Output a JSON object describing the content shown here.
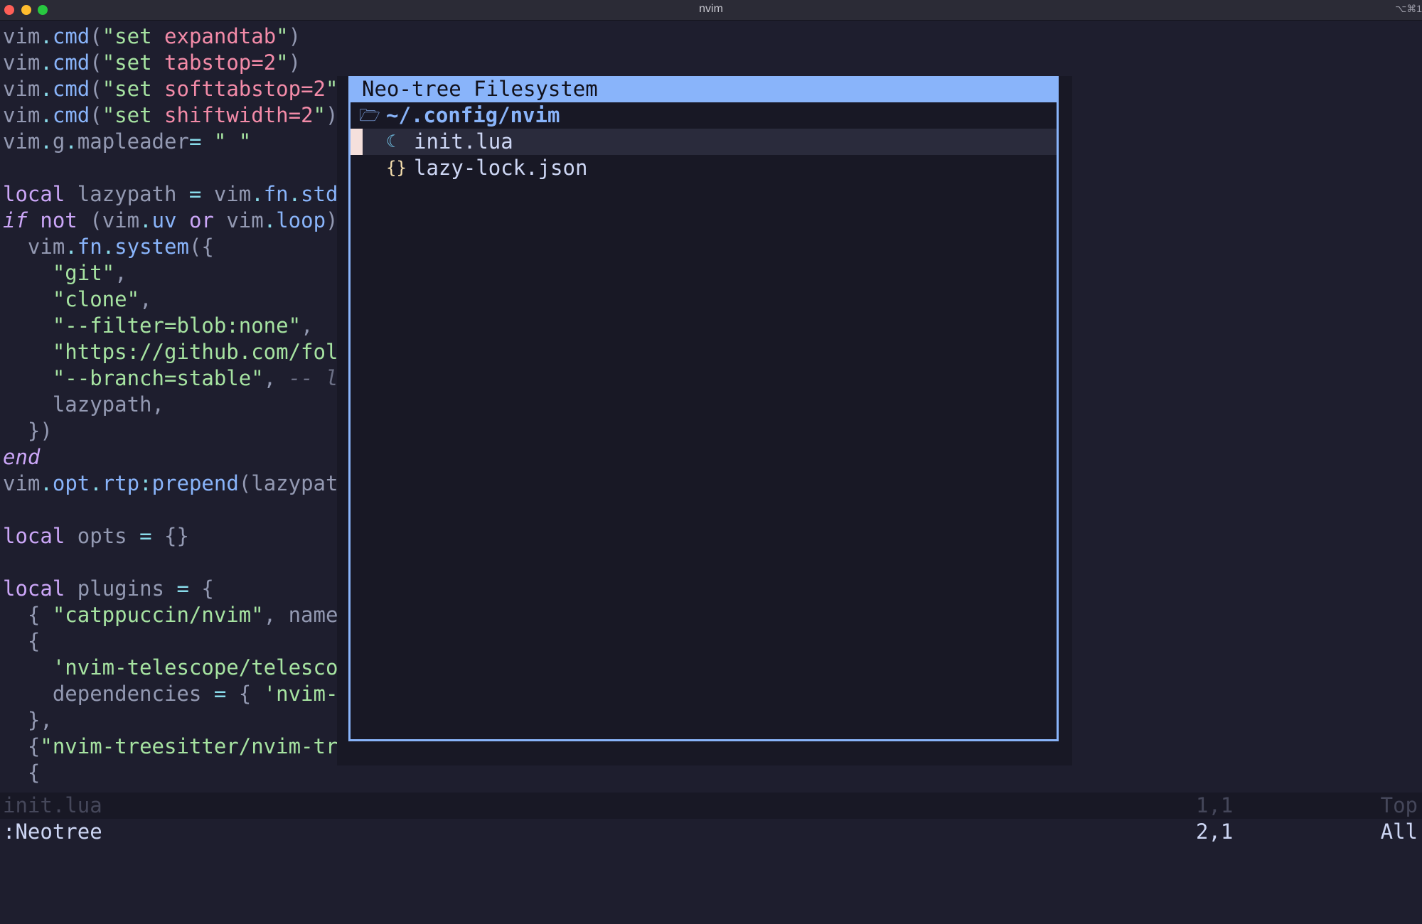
{
  "window": {
    "title": "nvim",
    "shortcut": "⌥⌘1"
  },
  "editor": {
    "lines": [
      [
        [
          "pc",
          "vim"
        ],
        [
          "op",
          "."
        ],
        [
          "fn",
          "cmd"
        ],
        [
          "pc",
          "("
        ],
        [
          "str",
          "\"set "
        ],
        [
          "tk",
          "expandtab"
        ],
        [
          "str",
          "\""
        ],
        [
          "pc",
          ")"
        ]
      ],
      [
        [
          "pc",
          "vim"
        ],
        [
          "op",
          "."
        ],
        [
          "fn",
          "cmd"
        ],
        [
          "pc",
          "("
        ],
        [
          "str",
          "\"set "
        ],
        [
          "tk",
          "tabstop=2"
        ],
        [
          "str",
          "\""
        ],
        [
          "pc",
          ")"
        ]
      ],
      [
        [
          "pc",
          "vim"
        ],
        [
          "op",
          "."
        ],
        [
          "fn",
          "cmd"
        ],
        [
          "pc",
          "("
        ],
        [
          "str",
          "\"set "
        ],
        [
          "tk",
          "softtabstop=2"
        ],
        [
          "str",
          "\""
        ]
      ],
      [
        [
          "pc",
          "vim"
        ],
        [
          "op",
          "."
        ],
        [
          "fn",
          "cmd"
        ],
        [
          "pc",
          "("
        ],
        [
          "str",
          "\"set "
        ],
        [
          "tk",
          "shiftwidth=2"
        ],
        [
          "str",
          "\""
        ],
        [
          "pc",
          ")"
        ]
      ],
      [
        [
          "pc",
          "vim"
        ],
        [
          "op",
          "."
        ],
        [
          "pc",
          "g"
        ],
        [
          "op",
          "."
        ],
        [
          "pc",
          "mapleader"
        ],
        [
          "op",
          "="
        ],
        [
          "pc",
          " "
        ],
        [
          "str",
          "\" \""
        ]
      ],
      [],
      [
        [
          "kw",
          "local"
        ],
        [
          "pc",
          " lazypath "
        ],
        [
          "op",
          "="
        ],
        [
          "pc",
          " vim"
        ],
        [
          "op",
          "."
        ],
        [
          "fn",
          "fn"
        ],
        [
          "op",
          "."
        ],
        [
          "fn",
          "std"
        ]
      ],
      [
        [
          "ikw",
          "if"
        ],
        [
          "pc",
          " "
        ],
        [
          "kw",
          "not"
        ],
        [
          "pc",
          " (vim"
        ],
        [
          "op",
          "."
        ],
        [
          "fn",
          "uv"
        ],
        [
          "pc",
          " "
        ],
        [
          "kw",
          "or"
        ],
        [
          "pc",
          " vim"
        ],
        [
          "op",
          "."
        ],
        [
          "fn",
          "loop"
        ],
        [
          "pc",
          ")"
        ]
      ],
      [
        [
          "pc",
          "  vim"
        ],
        [
          "op",
          "."
        ],
        [
          "fn",
          "fn"
        ],
        [
          "op",
          "."
        ],
        [
          "fn",
          "system"
        ],
        [
          "pc",
          "({"
        ]
      ],
      [
        [
          "pc",
          "    "
        ],
        [
          "str",
          "\"git\""
        ],
        [
          "pc",
          ","
        ]
      ],
      [
        [
          "pc",
          "    "
        ],
        [
          "str",
          "\"clone\""
        ],
        [
          "pc",
          ","
        ]
      ],
      [
        [
          "pc",
          "    "
        ],
        [
          "str",
          "\"--filter=blob:none\""
        ],
        [
          "pc",
          ","
        ]
      ],
      [
        [
          "pc",
          "    "
        ],
        [
          "str",
          "\"https://github.com/fol"
        ]
      ],
      [
        [
          "pc",
          "    "
        ],
        [
          "str",
          "\"--branch=stable\""
        ],
        [
          "pc",
          ", "
        ],
        [
          "cmt",
          "-- l"
        ]
      ],
      [
        [
          "pc",
          "    lazypath,"
        ]
      ],
      [
        [
          "pc",
          "  })"
        ]
      ],
      [
        [
          "ikw",
          "end"
        ]
      ],
      [
        [
          "pc",
          "vim"
        ],
        [
          "op",
          "."
        ],
        [
          "fn",
          "opt"
        ],
        [
          "op",
          "."
        ],
        [
          "fn",
          "rtp"
        ],
        [
          "op",
          ":"
        ],
        [
          "fn",
          "prepend"
        ],
        [
          "pc",
          "(lazypat"
        ]
      ],
      [],
      [
        [
          "kw",
          "local"
        ],
        [
          "pc",
          " opts "
        ],
        [
          "op",
          "="
        ],
        [
          "pc",
          " {}"
        ]
      ],
      [],
      [
        [
          "kw",
          "local"
        ],
        [
          "pc",
          " plugins "
        ],
        [
          "op",
          "="
        ],
        [
          "pc",
          " {"
        ]
      ],
      [
        [
          "pc",
          "  { "
        ],
        [
          "str",
          "\"catppuccin/nvim\""
        ],
        [
          "pc",
          ", name"
        ]
      ],
      [
        [
          "pc",
          "  {"
        ]
      ],
      [
        [
          "pc",
          "    "
        ],
        [
          "str",
          "'nvim-telescope/telesco"
        ]
      ],
      [
        [
          "pc",
          "    dependencies "
        ],
        [
          "op",
          "="
        ],
        [
          "pc",
          " { "
        ],
        [
          "str",
          "'nvim-"
        ]
      ],
      [
        [
          "pc",
          "  },"
        ]
      ],
      [
        [
          "pc",
          "  {"
        ],
        [
          "str",
          "\"nvim-treesitter/nvim-tr"
        ]
      ],
      [
        [
          "pc",
          "  {"
        ]
      ]
    ]
  },
  "neotree": {
    "title": "Neo-tree Filesystem",
    "root": {
      "icon": "open-folder-icon",
      "glyph": "🗁",
      "label": "~/.config/nvim"
    },
    "items": [
      {
        "icon": "lua-file-icon",
        "glyph": "☾",
        "label": "init.lua",
        "selected": true
      },
      {
        "icon": "json-file-icon",
        "glyph": "{}",
        "label": "lazy-lock.json",
        "selected": false
      }
    ]
  },
  "statusline": {
    "file": "init.lua",
    "position": "1,1",
    "scroll": "Top"
  },
  "cmdline": {
    "text": ":Neotree",
    "position": "2,1",
    "scroll": "All"
  },
  "colors": {
    "background": "#1e1e2e",
    "float_border": "#89b4fa",
    "cursor": "#f5e0dc"
  }
}
